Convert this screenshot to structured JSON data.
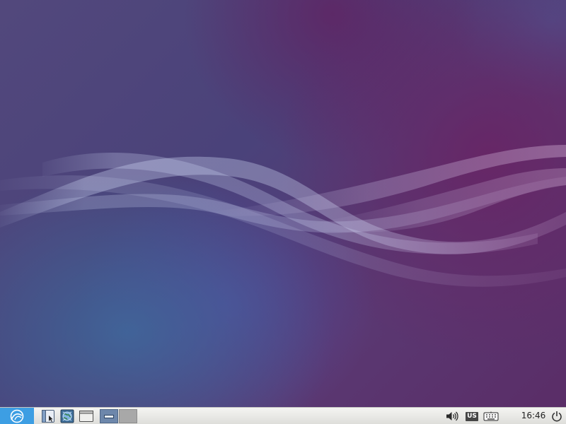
{
  "desktop": {
    "wallpaper": "lubuntu-waves",
    "colors": {
      "purple": "#5a2d67",
      "blue": "#3f6e9e",
      "violet": "#4a427a",
      "accent": "#3d9ee3"
    }
  },
  "taskbar": {
    "start_menu_icon": "lubuntu-logo-icon",
    "launchers": [
      {
        "name": "file-manager",
        "icon": "file-manager-icon"
      },
      {
        "name": "web-browser",
        "icon": "browser-icon"
      },
      {
        "name": "show-desktop",
        "icon": "window-icon"
      }
    ],
    "desktops": [
      {
        "id": 1,
        "active": true
      },
      {
        "id": 2,
        "active": false
      }
    ],
    "tray": {
      "volume_icon": "speaker-icon",
      "keyboard_layout": "US",
      "keyboard_icon": "keyboard-icon"
    },
    "clock": "16:46",
    "power_icon": "power-icon"
  }
}
